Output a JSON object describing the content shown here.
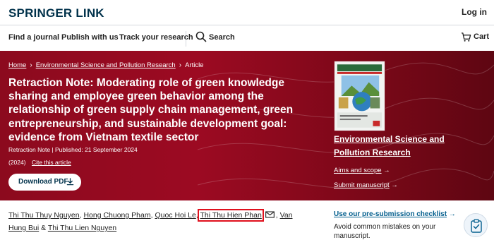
{
  "header": {
    "logo": "SPRINGER LINK",
    "login": "Log in"
  },
  "nav": {
    "items": [
      "Find a journal",
      "Publish with us",
      "Track your research"
    ],
    "search": "Search",
    "cart": "Cart"
  },
  "breadcrumb": [
    "Home",
    "Environmental Science and Pollution Research",
    "Article"
  ],
  "article": {
    "title": "Retraction Note: Moderating role of green knowledge sharing and employee green behavior among the relationship of green supply chain management, green entrepreneurship, and sustainable development goal: evidence from Vietnam textile sector",
    "type": "Retraction Note",
    "published": "Published: 21 September 2024",
    "year": "(2024)",
    "cite": "Cite this article",
    "download": "Download PDF"
  },
  "journal": {
    "name": "Environmental Science and Pollution Research",
    "aims": "Aims and scope",
    "submit": "Submit manuscript"
  },
  "authors": {
    "a1": "Thi Thu Thuy Nguyen",
    "a2": "Hong Chuong Pham",
    "a3": "Quoc Hoi Le",
    "a4": "Thi Thu Hien Phan",
    "a5": "Van Hung Bui",
    "a6": "Thi Thu Lien Nguyen"
  },
  "sidebar": {
    "checklist": "Use our pre-submission checklist",
    "avoid": "Avoid common mistakes on your manuscript."
  },
  "colors": {
    "hero": "#8c0a1e",
    "link": "#025e8d",
    "highlight": "#e0101d"
  }
}
